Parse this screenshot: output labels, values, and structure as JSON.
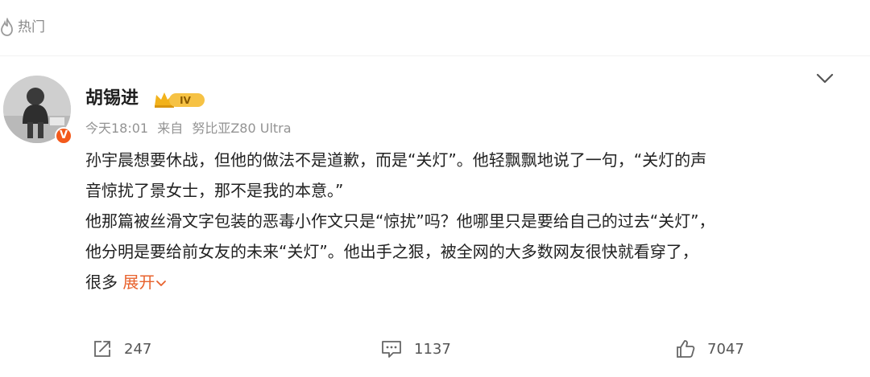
{
  "section": {
    "hot_label": "热门",
    "hot_icon": "flame-icon"
  },
  "post": {
    "author": "胡锡进",
    "level_badge_text": "IV",
    "verified_badge": "V",
    "timestamp": "今天18:01",
    "source_prefix": "来自",
    "source": "努比亚Z80 Ultra",
    "lines": [
      "孙宇晨想要休战，但他的做法不是道歉，而是“关灯”。他轻飘飘地说了一句，“关灯的声",
      "音惊扰了景女士，那不是我的本意。”",
      "他那篇被丝滑文字包装的恶毒小作文只是“惊扰”吗？他哪里只是要给自己的过去“关灯”，",
      "他分明是要给前女友的未来“关灯”。他出手之狠，被全网的大多数网友很快就看穿了，"
    ],
    "last_line_prefix": "很多",
    "expand_label": "展开",
    "colors": {
      "accent": "#e8622d",
      "badge_orange": "#f35a1c",
      "meta_gray": "#939393"
    }
  },
  "actions": {
    "repost_count": "247",
    "comment_count": "1137",
    "like_count": "7047"
  }
}
